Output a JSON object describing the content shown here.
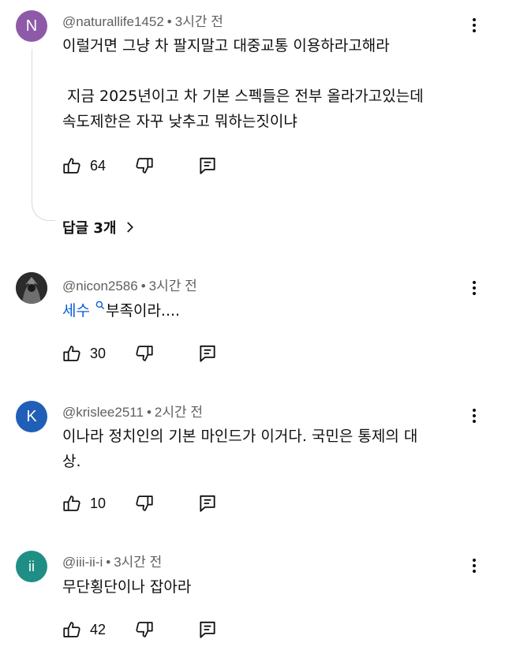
{
  "comments": [
    {
      "avatar_letter": "N",
      "avatar_color": "#8e5aa8",
      "handle": "@naturallife1452",
      "time": "3시간 전",
      "lines": [
        "이럴거면 그냥 차 팔지말고 대중교통 이용하라고해라",
        "",
        " 지금 2025년이고 차 기본 스펙들은 전부 올라가고있는데",
        "속도제한은 자꾸 낮추고 뭐하는짓이냐"
      ],
      "likes": "64",
      "replies_label": "답글 3개"
    },
    {
      "avatar_letter": "",
      "avatar_color": "#3a3a3a",
      "handle": "@nicon2586",
      "time": "3시간 전",
      "link_text": "세수",
      "link_suffix": "부족이라....",
      "likes": "30"
    },
    {
      "avatar_letter": "K",
      "avatar_color": "#1f5fb8",
      "handle": "@krislee2511",
      "time": "2시간 전",
      "lines": [
        "이나라 정치인의 기본 마인드가 이거다. 국민은 통제의 대",
        "상."
      ],
      "likes": "10"
    },
    {
      "avatar_letter": "ii",
      "avatar_color": "#1f8f86",
      "handle": "@iii-ii-i",
      "time": "3시간 전",
      "lines": [
        "무단횡단이나 잡아라"
      ],
      "likes": "42"
    }
  ]
}
